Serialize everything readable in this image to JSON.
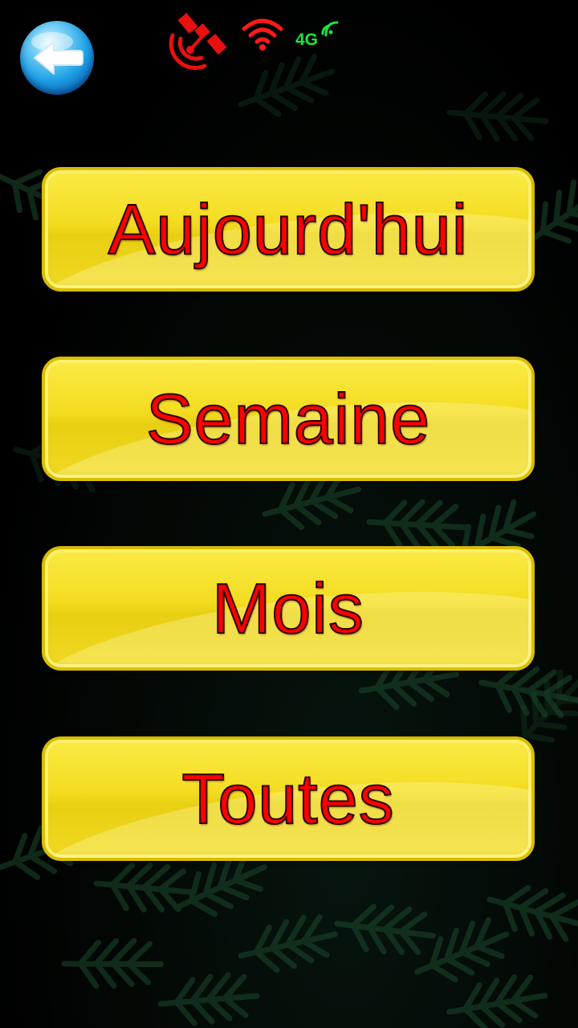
{
  "status": {
    "satellite_icon": "satellite-icon",
    "satellite_color": "#e81010",
    "wifi_icon": "wifi-icon",
    "wifi_color": "#ff1a1a",
    "network_label": "4G",
    "network_color": "#16e63a"
  },
  "header": {
    "back_icon": "back-arrow-icon"
  },
  "menu": {
    "items": [
      {
        "label": "Aujourd'hui"
      },
      {
        "label": "Semaine"
      },
      {
        "label": "Mois"
      },
      {
        "label": "Toutes"
      }
    ]
  },
  "colors": {
    "button_fill": "#f3dc20",
    "button_text": "#ff0000",
    "background": "#000000"
  }
}
